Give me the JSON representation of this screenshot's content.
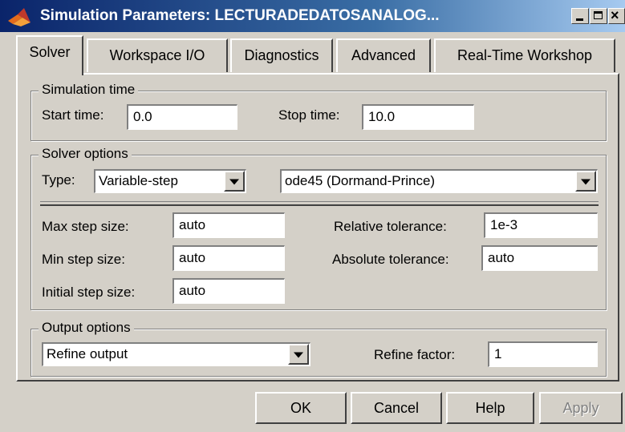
{
  "window": {
    "title": "Simulation Parameters: LECTURADEDATOSANALOG...",
    "icon": "matlab-logo-icon",
    "controls": [
      "minimize-icon",
      "maximize-icon",
      "close-icon"
    ]
  },
  "tabs": [
    {
      "label": "Solver",
      "active": true
    },
    {
      "label": "Workspace I/O",
      "active": false
    },
    {
      "label": "Diagnostics",
      "active": false
    },
    {
      "label": "Advanced",
      "active": false
    },
    {
      "label": "Real-Time Workshop",
      "active": false
    }
  ],
  "simulation_time": {
    "title": "Simulation time",
    "start_label": "Start time:",
    "start_value": "0.0",
    "stop_label": "Stop time:",
    "stop_value": "10.0"
  },
  "solver_options": {
    "title": "Solver options",
    "type_label": "Type:",
    "type_value": "Variable-step",
    "solver_value": "ode45 (Dormand-Prince)",
    "max_step_label": "Max step size:",
    "max_step_value": "auto",
    "min_step_label": "Min step size:",
    "min_step_value": "auto",
    "initial_step_label": "Initial step size:",
    "initial_step_value": "auto",
    "rel_tol_label": "Relative tolerance:",
    "rel_tol_value": "1e-3",
    "abs_tol_label": "Absolute tolerance:",
    "abs_tol_value": "auto"
  },
  "output_options": {
    "title": "Output options",
    "mode_value": "Refine output",
    "refine_label": "Refine factor:",
    "refine_value": "1"
  },
  "buttons": {
    "ok": "OK",
    "cancel": "Cancel",
    "help": "Help",
    "apply": "Apply"
  }
}
